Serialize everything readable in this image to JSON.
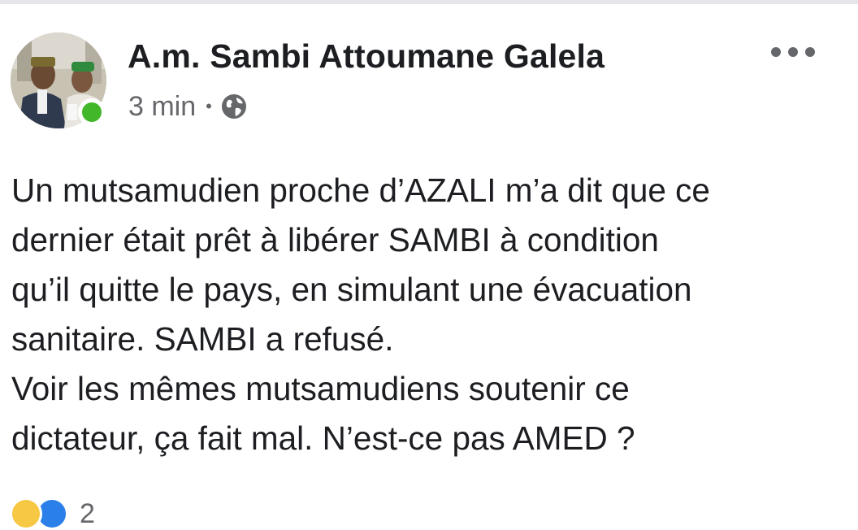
{
  "post": {
    "author": "A.m. Sambi Attoumane Galela",
    "time": "3 min",
    "separator": "•",
    "audience_icon": "globe-icon",
    "more_icon": "more-horizontal-icon",
    "avatar_online": true,
    "paragraphs": [
      "Un mutsamudien proche d’AZALI m’a dit que ce",
      "dernier était prêt à libérer SAMBI à condition",
      "qu’il quitte le pays, en simulant une évacuation",
      "sanitaire. SAMBI a refusé.",
      "Voir les mêmes mutsamudiens soutenir ce",
      "dictateur, ça fait mal. N’est-ce pas AMED ?"
    ],
    "reactions": {
      "icons": [
        "haha-reaction-icon",
        "like-reaction-icon"
      ],
      "count": "2"
    }
  },
  "colors": {
    "text": "#1c1e21",
    "secondary": "#65676b",
    "online": "#42b72a",
    "like": "#2a7fe8",
    "haha": "#f7c843"
  }
}
